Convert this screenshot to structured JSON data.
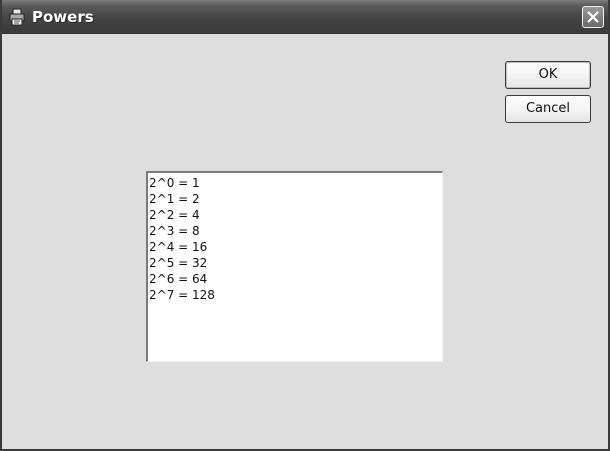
{
  "window": {
    "title": "Powers",
    "title_icon": "printer-icon",
    "close_icon": "close-icon"
  },
  "buttons": {
    "ok_label": "OK",
    "cancel_label": "Cancel"
  },
  "list": {
    "items": [
      "2^0 = 1",
      "2^1 = 2",
      "2^2 = 4",
      "2^3 = 8",
      "2^4 = 16",
      "2^5 = 32",
      "2^6 = 64",
      "2^7 = 128"
    ]
  },
  "colors": {
    "titlebar": "#444444",
    "client_background": "#dedede",
    "list_background": "#ffffff"
  }
}
